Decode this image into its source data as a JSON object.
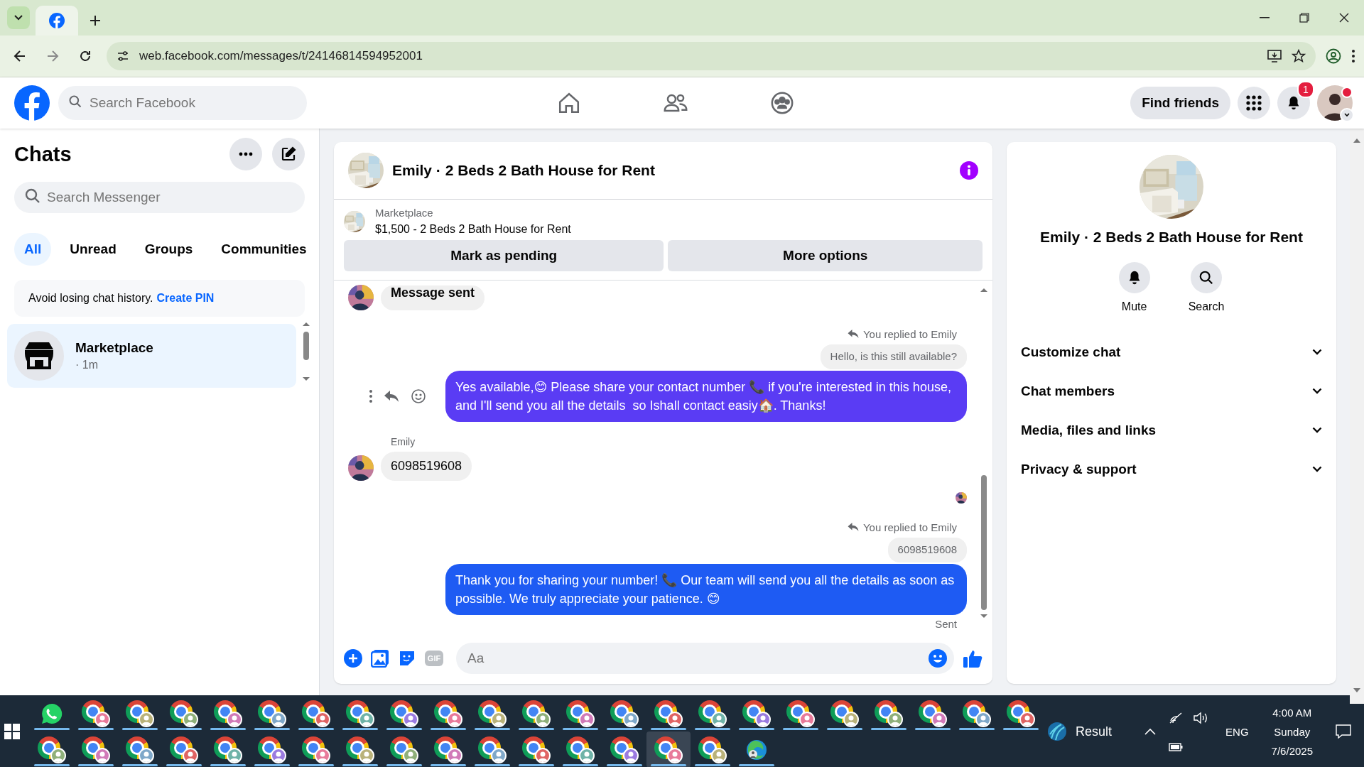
{
  "browser": {
    "url": "web.facebook.com/messages/t/24146814594952001"
  },
  "header": {
    "search_placeholder": "Search Facebook",
    "nav": [
      {
        "kind": "home"
      },
      {
        "kind": "friends"
      },
      {
        "kind": "groups"
      }
    ],
    "find_friends": "Find friends",
    "notification_count": "1"
  },
  "sidebar": {
    "title": "Chats",
    "search_placeholder": "Search Messenger",
    "filters": [
      {
        "label": "All",
        "selected": true
      },
      {
        "label": "Unread",
        "selected": false
      },
      {
        "label": "Groups",
        "selected": false
      },
      {
        "label": "Communities",
        "selected": false
      }
    ],
    "notice": {
      "text": "Avoid losing chat history.",
      "link": "Create PIN"
    },
    "chats": [
      {
        "name": "Marketplace",
        "meta": "· 1m",
        "selected": true
      }
    ]
  },
  "conversation": {
    "title": "Emily · 2 Beds 2 Bath House for Rent",
    "listing": {
      "source": "Marketplace",
      "title": "$1,500 - 2 Beds 2 Bath House for Rent"
    },
    "actions": [
      "Mark as pending",
      "More options"
    ],
    "messages": [
      {
        "kind": "incoming",
        "text": "Message sent",
        "emphasis": true
      },
      {
        "kind": "reply_label",
        "text": "You replied to Emily"
      },
      {
        "kind": "quoted",
        "text": "Hello, is this still available?"
      },
      {
        "kind": "outgoing",
        "text": "Yes available,😊 Please share your contact number 📞 if you're interested in this house, and I'll send you all the details  so Ishall contact easiy🏠. Thanks!",
        "color": "#5a3cf4",
        "hovered": true
      },
      {
        "kind": "sender",
        "text": "Emily"
      },
      {
        "kind": "incoming",
        "text": "6098519608",
        "emphasis": false
      },
      {
        "kind": "seen"
      },
      {
        "kind": "reply_label",
        "text": "You replied to Emily"
      },
      {
        "kind": "quoted",
        "text": "6098519608"
      },
      {
        "kind": "outgoing",
        "text": "Thank you for sharing your number! 📞 Our team will send you all the details as soon as possible. We truly appreciate your patience. 😊",
        "color": "#1e5bf3",
        "hovered": false
      },
      {
        "kind": "status",
        "text": "Sent"
      }
    ],
    "composer": {
      "placeholder": "Aa",
      "gif_label": "GIF"
    }
  },
  "details": {
    "title": "Emily · 2 Beds 2 Bath House for Rent",
    "actions": [
      {
        "kind": "mute",
        "label": "Mute"
      },
      {
        "kind": "search",
        "label": "Search"
      }
    ],
    "sections": [
      {
        "label": "Customize chat",
        "expanded": false
      },
      {
        "label": "Chat members",
        "expanded": false
      },
      {
        "label": "Media, files and links",
        "expanded": false
      },
      {
        "label": "Privacy & support",
        "expanded": false
      }
    ]
  },
  "taskbar": {
    "rows": [
      {
        "apps": [
          {
            "kind": "whatsapp",
            "selected": false
          },
          {
            "kind": "chrome",
            "selected": false
          },
          {
            "kind": "chrome",
            "selected": false
          },
          {
            "kind": "chrome",
            "selected": false
          },
          {
            "kind": "chrome",
            "selected": false
          },
          {
            "kind": "chrome",
            "selected": false
          },
          {
            "kind": "chrome",
            "selected": false
          },
          {
            "kind": "chrome",
            "selected": false
          },
          {
            "kind": "chrome",
            "selected": false
          },
          {
            "kind": "chrome",
            "selected": false
          },
          {
            "kind": "chrome",
            "selected": false
          },
          {
            "kind": "chrome",
            "selected": false
          },
          {
            "kind": "chrome",
            "selected": false
          },
          {
            "kind": "chrome",
            "selected": false
          },
          {
            "kind": "chrome",
            "selected": false
          },
          {
            "kind": "chrome",
            "selected": false
          },
          {
            "kind": "chrome",
            "selected": false
          },
          {
            "kind": "chrome",
            "selected": false
          },
          {
            "kind": "chrome",
            "selected": false
          },
          {
            "kind": "chrome",
            "selected": false
          },
          {
            "kind": "chrome",
            "selected": false
          },
          {
            "kind": "chrome",
            "selected": false
          },
          {
            "kind": "chrome",
            "selected": false
          }
        ]
      },
      {
        "apps": [
          {
            "kind": "chrome",
            "selected": false
          },
          {
            "kind": "chrome",
            "selected": false
          },
          {
            "kind": "chrome",
            "selected": false
          },
          {
            "kind": "chrome",
            "selected": false
          },
          {
            "kind": "chrome",
            "selected": false
          },
          {
            "kind": "chrome",
            "selected": false
          },
          {
            "kind": "chrome",
            "selected": false
          },
          {
            "kind": "chrome",
            "selected": false
          },
          {
            "kind": "chrome",
            "selected": false
          },
          {
            "kind": "chrome",
            "selected": false
          },
          {
            "kind": "chrome",
            "selected": false
          },
          {
            "kind": "chrome",
            "selected": false
          },
          {
            "kind": "chrome",
            "selected": false
          },
          {
            "kind": "chrome",
            "selected": false
          },
          {
            "kind": "chrome",
            "selected": true
          },
          {
            "kind": "chrome",
            "selected": false
          },
          {
            "kind": "edge",
            "selected": false
          }
        ]
      }
    ],
    "weather_label": "Result",
    "language": "ENG",
    "time": "4:00 AM",
    "day": "Sunday",
    "date": "7/6/2025"
  }
}
